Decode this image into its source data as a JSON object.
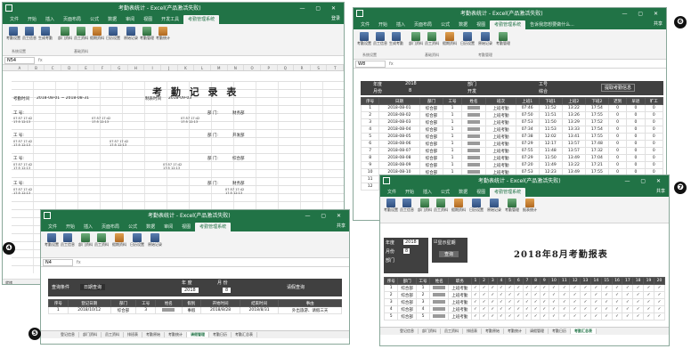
{
  "badges": {
    "w4": "❹",
    "w5": "❺",
    "w6": "❻",
    "w7": "❼"
  },
  "window_title": "考勤表统计 - Excel(产品激活失败)",
  "ribbon_tabs": [
    "文件",
    "开始",
    "插入",
    "页面布局",
    "公式",
    "数据",
    "审阅",
    "视图",
    "开发工具",
    "考勤管理系统"
  ],
  "tell_me": "告诉我您想要做什么...",
  "login": "登录",
  "share": "共享",
  "ribbon_buttons": [
    "考勤设置",
    "员工信息",
    "生成考勤表",
    "部门资料",
    "员工资料",
    "假期资料",
    "日历设置",
    "原始记录",
    "考勤管理",
    "考勤统计",
    "报表统计"
  ],
  "ribbon_groups": [
    "系统设置",
    "基础资料",
    "考勤管理",
    "考勤报表"
  ],
  "name_box_4": "N54",
  "name_box_5": "N4",
  "name_box_6": "W8",
  "fx": "fx",
  "w4": {
    "title": "考 勤 记 录 表",
    "period_label": "考勤时间",
    "period": "2018-08-01 ~ 2018-08-31",
    "made_label": "制表时间",
    "made": "2018-09-03",
    "emp_label": "工 号:",
    "dept_label": "部 门:",
    "depts": [
      "财务部",
      "开发部",
      "综合部",
      "财务部"
    ],
    "punch": "07:57 17:42 17:5 12:13",
    "status": "就绪"
  },
  "w5": {
    "header_cells": [
      "年 度",
      "2018",
      "月 份",
      "8"
    ],
    "query_label": "查询条件",
    "btn": "日期查询",
    "btn2": "请假查询",
    "cols": [
      "序号",
      "登记日期",
      "部门",
      "工号",
      "姓名",
      "假别",
      "开始时间",
      "结束时间",
      "事由"
    ],
    "row": [
      "1",
      "2018/10/12",
      "综合部",
      "3",
      "",
      "事假",
      "2018/8/28",
      "2018/8/31",
      "外出旅游、请假三天"
    ],
    "sheets": [
      "登记信息",
      "部门资料",
      "员工资料",
      "排班表",
      "考勤原始",
      "考勤统计",
      "请假管理",
      "考勤日历",
      "考勤汇总表",
      "考勤月报表"
    ],
    "active_sheet": "请假管理"
  },
  "w6": {
    "top_labels": [
      "年度",
      "月份",
      "部门",
      "工号",
      "2018",
      "8",
      "开发",
      "综合"
    ],
    "btn": "提取考勤信息",
    "cols": [
      "序号",
      "日期",
      "部门",
      "工号",
      "姓名",
      "班次",
      "上班1",
      "下班1",
      "上班2",
      "下班2",
      "迟到",
      "早退",
      "旷工"
    ],
    "rows": [
      [
        "1",
        "2018-08-01",
        "综合部",
        "1",
        "上班考勤",
        "07:46",
        "11:52",
        "13:22",
        "17:54",
        "0",
        "0",
        "0"
      ],
      [
        "2",
        "2018-08-02",
        "综合部",
        "1",
        "上班考勤",
        "07:50",
        "11:51",
        "13:26",
        "17:55",
        "0",
        "0",
        "0"
      ],
      [
        "3",
        "2018-08-03",
        "综合部",
        "1",
        "上班考勤",
        "07:53",
        "11:50",
        "13:29",
        "17:52",
        "0",
        "0",
        "0"
      ],
      [
        "4",
        "2018-08-04",
        "综合部",
        "1",
        "上班考勤",
        "07:34",
        "11:53",
        "13:33",
        "17:54",
        "0",
        "0",
        "0"
      ],
      [
        "5",
        "2018-08-05",
        "综合部",
        "1",
        "上班考勤",
        "07:38",
        "12:02",
        "13:41",
        "17:55",
        "0",
        "0",
        "0"
      ],
      [
        "6",
        "2018-08-06",
        "综合部",
        "1",
        "上班考勤",
        "07:29",
        "12:17",
        "13:57",
        "17:48",
        "0",
        "0",
        "0"
      ],
      [
        "7",
        "2018-08-07",
        "综合部",
        "1",
        "上班考勤",
        "07:55",
        "11:48",
        "13:57",
        "17:32",
        "0",
        "0",
        "0"
      ],
      [
        "8",
        "2018-08-08",
        "综合部",
        "1",
        "上班考勤",
        "07:29",
        "11:50",
        "13:49",
        "17:04",
        "0",
        "0",
        "0"
      ],
      [
        "9",
        "2018-08-09",
        "综合部",
        "1",
        "上班考勤",
        "07:20",
        "11:49",
        "13:22",
        "17:21",
        "0",
        "0",
        "0"
      ],
      [
        "10",
        "2018-08-10",
        "综合部",
        "1",
        "上班考勤",
        "07:53",
        "12:23",
        "13:49",
        "17:55",
        "0",
        "0",
        "0"
      ],
      [
        "11",
        "2018-08-11",
        "综合部",
        "1",
        "上班考勤",
        "07:52",
        "11:51",
        "13:26",
        "17:43",
        "0",
        "0",
        "0"
      ],
      [
        "12",
        "2018-08-12",
        "综合部",
        "1",
        "上班考勤",
        "07:50",
        "11:50",
        "13:50",
        "17:11",
        "0",
        "0",
        "0"
      ]
    ]
  },
  "w7": {
    "title": "2018年8月考勤报表",
    "ctrl_labels": [
      "年度",
      "月份",
      "部门"
    ],
    "ctrl_values": [
      "2018",
      "8",
      ""
    ],
    "checkbox": "显示星期",
    "btn": "查询",
    "cols": [
      "序号",
      "部门",
      "工号",
      "姓名",
      "职务"
    ],
    "rows": [
      [
        "1",
        "综合部",
        "1",
        "",
        "上班考勤"
      ],
      [
        "2",
        "综合部",
        "2",
        "",
        "上班考勤"
      ],
      [
        "3",
        "综合部",
        "3",
        "",
        "上班考勤"
      ],
      [
        "4",
        "综合部",
        "4",
        "",
        "上班考勤"
      ],
      [
        "5",
        "综合部",
        "5",
        "",
        "上班考勤"
      ]
    ],
    "check": "✓",
    "sheets": [
      "登记信息",
      "部门资料",
      "员工资料",
      "排班表",
      "考勤原始",
      "考勤统计",
      "请假管理",
      "考勤日历",
      "考勤汇总表"
    ],
    "active_sheet": "考勤汇总表"
  },
  "colors": {
    "excel_green": "#217346",
    "dark_bar": "#404040"
  }
}
